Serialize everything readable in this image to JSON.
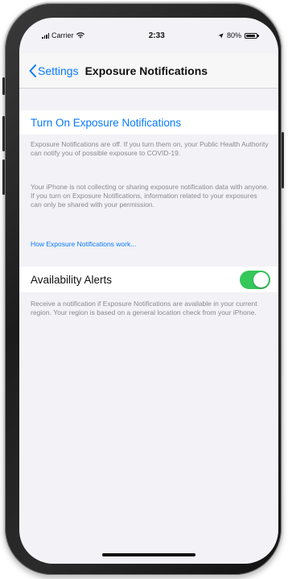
{
  "status_bar": {
    "carrier": "Carrier",
    "time": "2:33",
    "battery_percent": "80%"
  },
  "nav": {
    "back_label": "Settings",
    "title": "Exposure Notifications"
  },
  "turn_on": {
    "label": "Turn On Exposure Notifications"
  },
  "exposure_info": {
    "paragraph_1": "Exposure Notifications are off. If you turn them on, your Public Health Authority can notify you of possible exposure to COVID-19.",
    "paragraph_2": "Your iPhone is not collecting or sharing exposure notification data with anyone. If you turn on Exposure Notifications, information related to your exposures can only be shared with your permission.",
    "link": "How Exposure Notifications work..."
  },
  "availability": {
    "label": "Availability Alerts",
    "enabled": true,
    "description": "Receive a notification if Exposure Notifications are available in your current region. Your region is based on a general location check from your iPhone."
  },
  "colors": {
    "accent": "#0a7aff",
    "toggle_on": "#34c759",
    "background": "#f2f2f7"
  }
}
